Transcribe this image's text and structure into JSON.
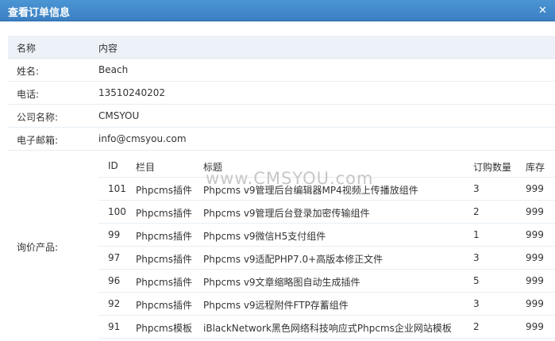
{
  "window": {
    "title": "查看订单信息"
  },
  "info": {
    "header": {
      "label": "名称",
      "value": "内容"
    },
    "fields": [
      {
        "label": "姓名:",
        "value": "Beach"
      },
      {
        "label": "电话:",
        "value": "13510240202"
      },
      {
        "label": "公司名称:",
        "value": "CMSYOU"
      },
      {
        "label": "电子邮箱:",
        "value": "info@cmsyou.com"
      }
    ]
  },
  "products": {
    "label": "询价产品:",
    "columns": {
      "id": "ID",
      "category": "栏目",
      "title": "标题",
      "qty": "订购数量",
      "stock": "库存"
    },
    "rows": [
      {
        "id": "101",
        "category": "Phpcms插件",
        "title": "Phpcms v9管理后台编辑器MP4视频上传播放组件",
        "qty": "3",
        "stock": "999"
      },
      {
        "id": "100",
        "category": "Phpcms插件",
        "title": "Phpcms v9管理后台登录加密传输组件",
        "qty": "2",
        "stock": "999"
      },
      {
        "id": "99",
        "category": "Phpcms插件",
        "title": "Phpcms v9微信H5支付组件",
        "qty": "1",
        "stock": "999"
      },
      {
        "id": "97",
        "category": "Phpcms插件",
        "title": "Phpcms v9适配PHP7.0+高版本修正文件",
        "qty": "3",
        "stock": "999"
      },
      {
        "id": "96",
        "category": "Phpcms插件",
        "title": "Phpcms v9文章缩略图自动生成插件",
        "qty": "5",
        "stock": "999"
      },
      {
        "id": "92",
        "category": "Phpcms插件",
        "title": "Phpcms v9远程附件FTP存蓄组件",
        "qty": "3",
        "stock": "999"
      },
      {
        "id": "91",
        "category": "Phpcms模板",
        "title": "iBlackNetwork黑色网络科技响应式Phpcms企业网站模板",
        "qty": "2",
        "stock": "999"
      }
    ]
  },
  "watermark": "www.CMSYOU.com"
}
